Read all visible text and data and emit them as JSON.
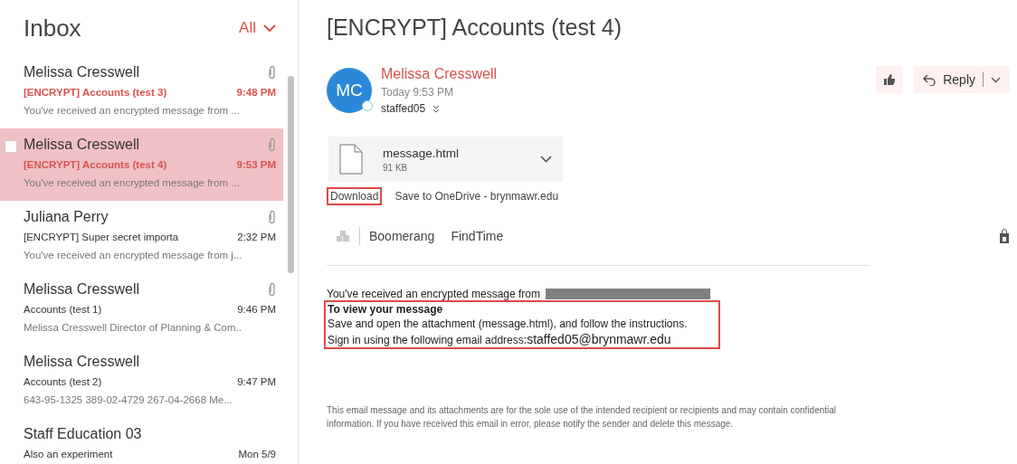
{
  "folder": {
    "title": "Inbox",
    "filter": "All"
  },
  "messages": [
    {
      "sender": "Melissa Cresswell",
      "subject": "[ENCRYPT] Accounts (test 3)",
      "time": "9:48 PM",
      "preview": "You've received an encrypted message from ...",
      "attachment": true,
      "unread": true,
      "selected": false
    },
    {
      "sender": "Melissa Cresswell",
      "subject": "[ENCRYPT] Accounts (test 4)",
      "time": "9:53 PM",
      "preview": "You've received an encrypted message from ...",
      "attachment": true,
      "unread": true,
      "selected": true
    },
    {
      "sender": "Juliana Perry",
      "subject": "[ENCRYPT] Super secret importa",
      "time": "2:32 PM",
      "preview": "You've received an encrypted message from j...",
      "attachment": true,
      "unread": false,
      "selected": false
    },
    {
      "sender": "Melissa Cresswell",
      "subject": "Accounts (test 1)",
      "time": "9:46 PM",
      "preview": "Melissa Cresswell  Director of Planning & Com..",
      "attachment": true,
      "unread": false,
      "selected": false
    },
    {
      "sender": "Melissa Cresswell",
      "subject": "Accounts (test 2)",
      "time": "9:47 PM",
      "preview": "643-95-1325 389-02-4729 267-04-2668    Me...",
      "attachment": false,
      "unread": false,
      "selected": false
    },
    {
      "sender": "Staff Education 03",
      "subject": "Also an experiment",
      "time": "Mon 5/9",
      "attachment": false,
      "unread": false,
      "selected": false
    }
  ],
  "reading": {
    "title": "[ENCRYPT] Accounts (test 4)",
    "initials": "MC",
    "sender": "Melissa Cresswell",
    "date": "Today 9:53 PM",
    "to": "staffed05",
    "reply": "Reply",
    "attachment": {
      "name": "message.html",
      "size": "91 KB"
    },
    "attachment_actions": [
      {
        "label": "Download",
        "highlighted": true
      },
      {
        "label": "Save to OneDrive - brynmawr.edu",
        "highlighted": false
      }
    ],
    "addins": [
      "Boomerang",
      "FindTime"
    ],
    "body": {
      "intro": "You've received an encrypted message from",
      "heading": "To view your message",
      "lines": [
        "Save and open the attachment (message.html), and follow the instructions.",
        "Sign in using the following email address:"
      ],
      "email": "staffed05@brynmawr.edu",
      "highlighted": true
    },
    "footer": "This email message and its attachments are for the sole use of the intended recipient or recipients and may contain confidential information. If you have received this email in error, please notify the sender and delete this message."
  }
}
